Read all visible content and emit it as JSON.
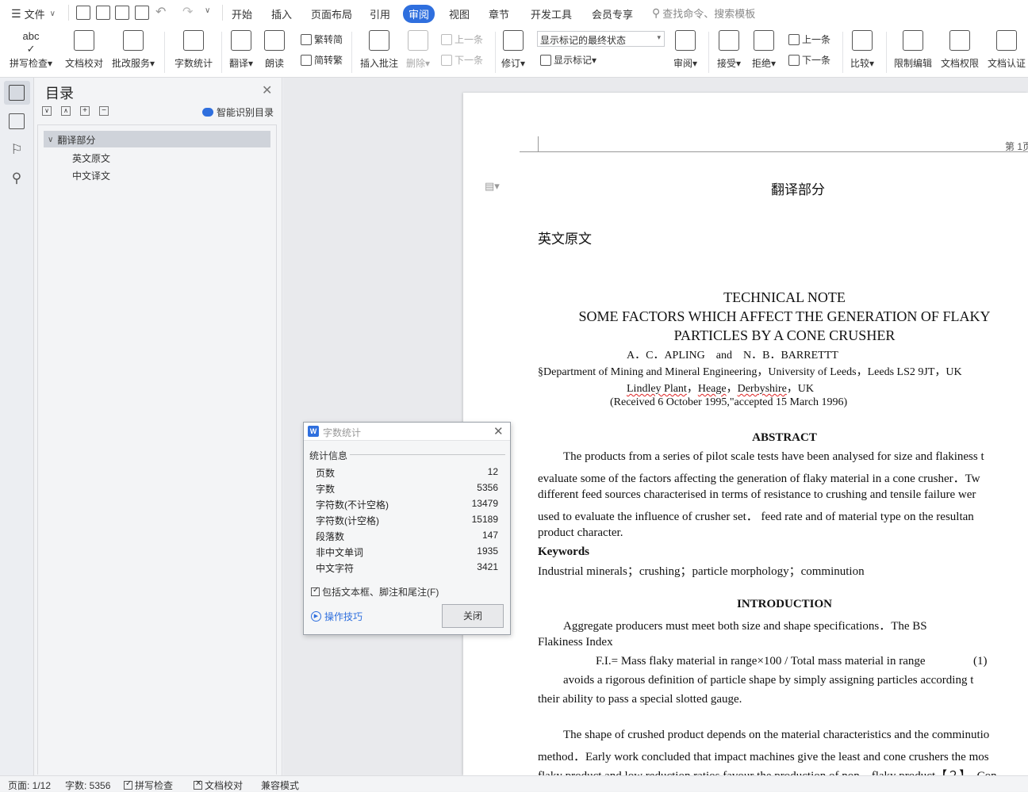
{
  "menubar": {
    "file_label": "文件",
    "tabs": [
      "开始",
      "插入",
      "页面布局",
      "引用",
      "审阅",
      "视图",
      "章节",
      "开发工具",
      "会员专享"
    ],
    "active_tab": "审阅",
    "search_placeholder": "查找命令、搜索模板"
  },
  "ribbon": {
    "spellcheck": "拼写检查",
    "doc_proof": "文档校对",
    "review_service": "批改服务",
    "word_count": "字数统计",
    "translate": "翻译",
    "read_aloud": "朗读",
    "trad_to_simp": "繁转简",
    "simp_to_trad": "简转繁",
    "insert_comment": "插入批注",
    "delete": "删除",
    "prev_comment": "上一条",
    "next_comment": "下一条",
    "track_changes": "修订",
    "markup_state": "显示标记的最终状态",
    "show_markup": "显示标记",
    "review": "审阅",
    "accept": "接受",
    "reject": "拒绝",
    "prev_change": "上一条",
    "next_change": "下一条",
    "compare": "比较",
    "restrict_edit": "限制编辑",
    "doc_permission": "文档权限",
    "doc_certify": "文档认证"
  },
  "toc": {
    "title": "目录",
    "smart_recognize": "智能识别目录",
    "items": [
      {
        "label": "翻译部分",
        "level": 1,
        "selected": true
      },
      {
        "label": "英文原文",
        "level": 2
      },
      {
        "label": "中文译文",
        "level": 2
      }
    ]
  },
  "document": {
    "header_page": "第 1页",
    "section_title": "翻译部分",
    "subsection": "英文原文",
    "note_title": "TECHNICAL NOTE",
    "paper_title_1": "SOME FACTORS WHICH AFFECT THE GENERATION OF FLAKY",
    "paper_title_2": "PARTICLES BY A CONE CRUSHER",
    "authors": "A．C．APLING　and　N．B．BARRETTT",
    "affiliation": "§Department of Mining and Mineral Engineering，University of Leeds，Leeds LS2 9JT，UK",
    "address_parts": [
      "Lindley Plant",
      "，",
      "Heage",
      "，",
      "Derbyshire",
      "，UK"
    ],
    "received": "(Received 6 October 1995,\"accepted 15 March 1996)",
    "abstract_heading": "ABSTRACT",
    "abstract_lines": [
      "The products from a series of pilot scale tests have been analysed for size and flakiness t",
      "evaluate some of the factors affecting the generation of flaky material in a cone crusher．Tw",
      "different feed sources characterised in terms of resistance to crushing and tensile failure wer",
      "used to evaluate the influence of crusher set． feed rate and of material type on the resultan",
      "product character."
    ],
    "keywords_heading": "Keywords",
    "keywords": "Industrial minerals；crushing；particle morphology；comminution",
    "intro_heading": "INTRODUCTION",
    "intro_line1": "Aggregate producers must meet both size and shape specifications．The BS",
    "intro_line2": "Flakiness Index",
    "equation": "F.I.= Mass flaky material in range×100 / Total mass material in range",
    "equation_no": "(1)",
    "intro_line3": "avoids a rigorous definition of particle shape by simply assigning particles according t",
    "intro_line4": "their ability to pass a special slotted gauge.",
    "para2_line1": "The shape of crushed product depends on the material characteristics and the comminutio",
    "para2_line2": "method．Early work concluded that impact machines give the least and cone crushers the mos",
    "para2_line3": "flaky product and low reduction ratios favour the production of non—flaky product【２】．Con"
  },
  "dialog": {
    "title": "字数统计",
    "section": "统计信息",
    "stats": [
      {
        "label": "页数",
        "value": "12"
      },
      {
        "label": "字数",
        "value": "5356"
      },
      {
        "label": "字符数(不计空格)",
        "value": "13479"
      },
      {
        "label": "字符数(计空格)",
        "value": "15189"
      },
      {
        "label": "段落数",
        "value": "147"
      },
      {
        "label": "非中文单词",
        "value": "1935"
      },
      {
        "label": "中文字符",
        "value": "3421"
      }
    ],
    "include_checkbox": "包括文本框、脚注和尾注(F)",
    "tips_link": "操作技巧",
    "close_button": "关闭"
  },
  "status": {
    "page": "页面: 1/12",
    "words": "字数: 5356",
    "spellcheck": "拼写检查",
    "proofread": "文档校对",
    "compat": "兼容模式"
  },
  "colors": {
    "accent": "#2f6fde",
    "link": "#2f6fde"
  }
}
